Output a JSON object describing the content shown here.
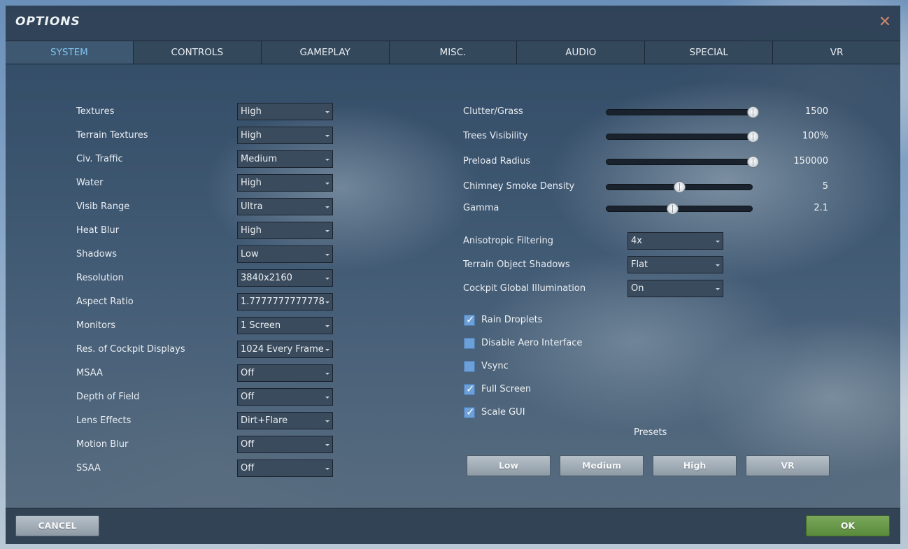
{
  "window": {
    "title": "OPTIONS"
  },
  "tabs": [
    "SYSTEM",
    "CONTROLS",
    "GAMEPLAY",
    "MISC.",
    "AUDIO",
    "SPECIAL",
    "VR"
  ],
  "active_tab": "SYSTEM",
  "left_settings": [
    {
      "label": "Textures",
      "value": "High"
    },
    {
      "label": "Terrain Textures",
      "value": "High"
    },
    {
      "label": "Civ. Traffic",
      "value": "Medium"
    },
    {
      "label": "Water",
      "value": "High"
    },
    {
      "label": "Visib Range",
      "value": "Ultra"
    },
    {
      "label": "Heat Blur",
      "value": "High"
    },
    {
      "label": "Shadows",
      "value": "Low"
    },
    {
      "label": "Resolution",
      "value": "3840x2160"
    },
    {
      "label": "Aspect Ratio",
      "value": "1.7777777777778"
    },
    {
      "label": "Monitors",
      "value": "1 Screen"
    },
    {
      "label": "Res. of Cockpit Displays",
      "value": "1024 Every Frame"
    },
    {
      "label": "MSAA",
      "value": "Off"
    },
    {
      "label": "Depth of Field",
      "value": "Off"
    },
    {
      "label": "Lens Effects",
      "value": "Dirt+Flare"
    },
    {
      "label": "Motion Blur",
      "value": "Off"
    },
    {
      "label": "SSAA",
      "value": "Off"
    }
  ],
  "sliders": [
    {
      "label": "Clutter/Grass",
      "value": "1500",
      "level": 1.0
    },
    {
      "label": "Trees Visibility",
      "value": "100%",
      "level": 1.0
    },
    {
      "label": "Preload Radius",
      "value": "150000",
      "level": 1.0
    },
    {
      "label": "Chimney Smoke Density",
      "value": "5",
      "level": 0.5
    },
    {
      "label": "Gamma",
      "value": "2.1",
      "level": 0.45
    }
  ],
  "right_selects": [
    {
      "label": "Anisotropic Filtering",
      "value": "4x"
    },
    {
      "label": "Terrain Object Shadows",
      "value": "Flat"
    },
    {
      "label": "Cockpit Global Illumination",
      "value": "On"
    }
  ],
  "checkboxes": [
    {
      "label": "Rain Droplets",
      "checked": true
    },
    {
      "label": "Disable Aero Interface",
      "checked": false
    },
    {
      "label": "Vsync",
      "checked": false
    },
    {
      "label": "Full Screen",
      "checked": true
    },
    {
      "label": "Scale GUI",
      "checked": true
    }
  ],
  "presets": {
    "label": "Presets",
    "buttons": [
      "Low",
      "Medium",
      "High",
      "VR"
    ]
  },
  "footer": {
    "cancel": "CANCEL",
    "ok": "OK"
  },
  "colors": {
    "active_tab_text": "#7fc4ef",
    "ok_button": "#5a8a3c",
    "close_icon": "#d0856b",
    "checkbox": "#6d9fd8"
  }
}
